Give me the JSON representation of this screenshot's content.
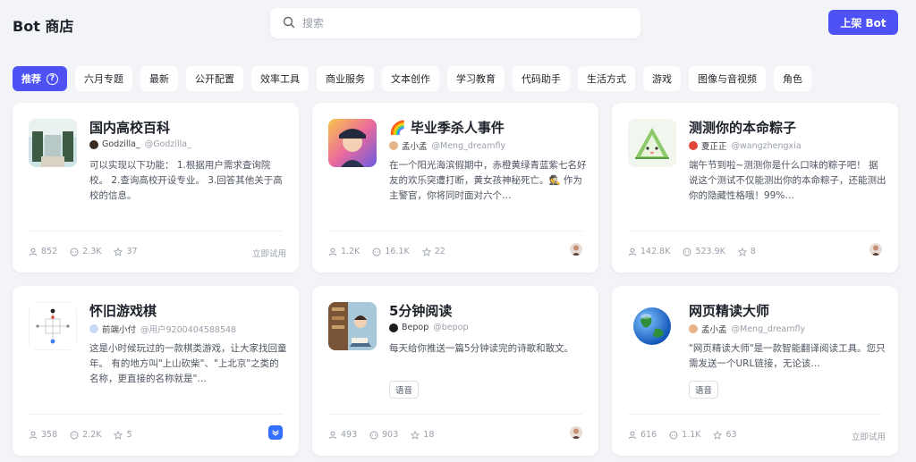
{
  "header": {
    "title": "Bot 商店",
    "search_placeholder": "搜索",
    "publish_label": "上架 Bot"
  },
  "tabs": [
    {
      "label": "推荐",
      "active": true
    },
    {
      "label": "六月专题"
    },
    {
      "label": "最新"
    },
    {
      "label": "公开配置"
    },
    {
      "label": "效率工具"
    },
    {
      "label": "商业服务"
    },
    {
      "label": "文本创作"
    },
    {
      "label": "学习教育"
    },
    {
      "label": "代码助手"
    },
    {
      "label": "生活方式"
    },
    {
      "label": "游戏"
    },
    {
      "label": "图像与音视频"
    },
    {
      "label": "角色"
    }
  ],
  "cards": [
    {
      "name": "国内高校百科",
      "author": "Godzilla_",
      "handle": "@Godzilla_",
      "desc": "可以实现以下功能： 1.根据用户需求查询院校。 2.查询高校开设专业。 3.回答其他关于高校的信息。",
      "users": "852",
      "chats": "2.3K",
      "stars": "37",
      "try_label": "立即试用"
    },
    {
      "name": "🌈 毕业季杀人事件",
      "author": "孟小孟",
      "handle": "@Meng_dreamfly",
      "desc": "在一个阳光海滨假期中，赤橙黄绿青蓝紫七名好友的欢乐突遭打断，黄女孩神秘死亡。🕵️ 作为主警官，你将同时面对六个…",
      "users": "1.2K",
      "chats": "16.1K",
      "stars": "22"
    },
    {
      "name": "测测你的本命粽子",
      "author": "夏正正",
      "handle": "@wangzhengxia",
      "desc": "端午节到啦~测测你是什么口味的粽子吧！ 据说这个测试不仅能测出你的本命粽子，还能测出你的隐藏性格哦！99%…",
      "users": "142.8K",
      "chats": "523.9K",
      "stars": "8"
    },
    {
      "name": "怀旧游戏棋",
      "author": "前端小付",
      "handle": "@用户9200404588548",
      "desc": "这是小时候玩过的一款棋类游戏，让大家找回童年。 有的地方叫\"上山砍柴\"、\"上北京\"之类的名称，更直接的名称就是\"…",
      "users": "358",
      "chats": "2.2K",
      "stars": "5"
    },
    {
      "name": "5分钟阅读",
      "author": "Bepop",
      "handle": "@bepop",
      "desc": "每天给你推送一篇5分钟读完的诗歌和散文。",
      "tag": "语音",
      "users": "493",
      "chats": "903",
      "stars": "18"
    },
    {
      "name": "网页精读大师",
      "author": "孟小孟",
      "handle": "@Meng_dreamfly",
      "desc": "\"网页精读大师\"是一款智能翻译阅读工具。您只需发送一个URL链接，无论该…",
      "tag": "语音",
      "users": "616",
      "chats": "1.1K",
      "stars": "63",
      "try_label": "立即试用"
    }
  ],
  "colors": {
    "accent": "#4e52f5",
    "background": "#f3f4f8",
    "card": "#ffffff"
  }
}
